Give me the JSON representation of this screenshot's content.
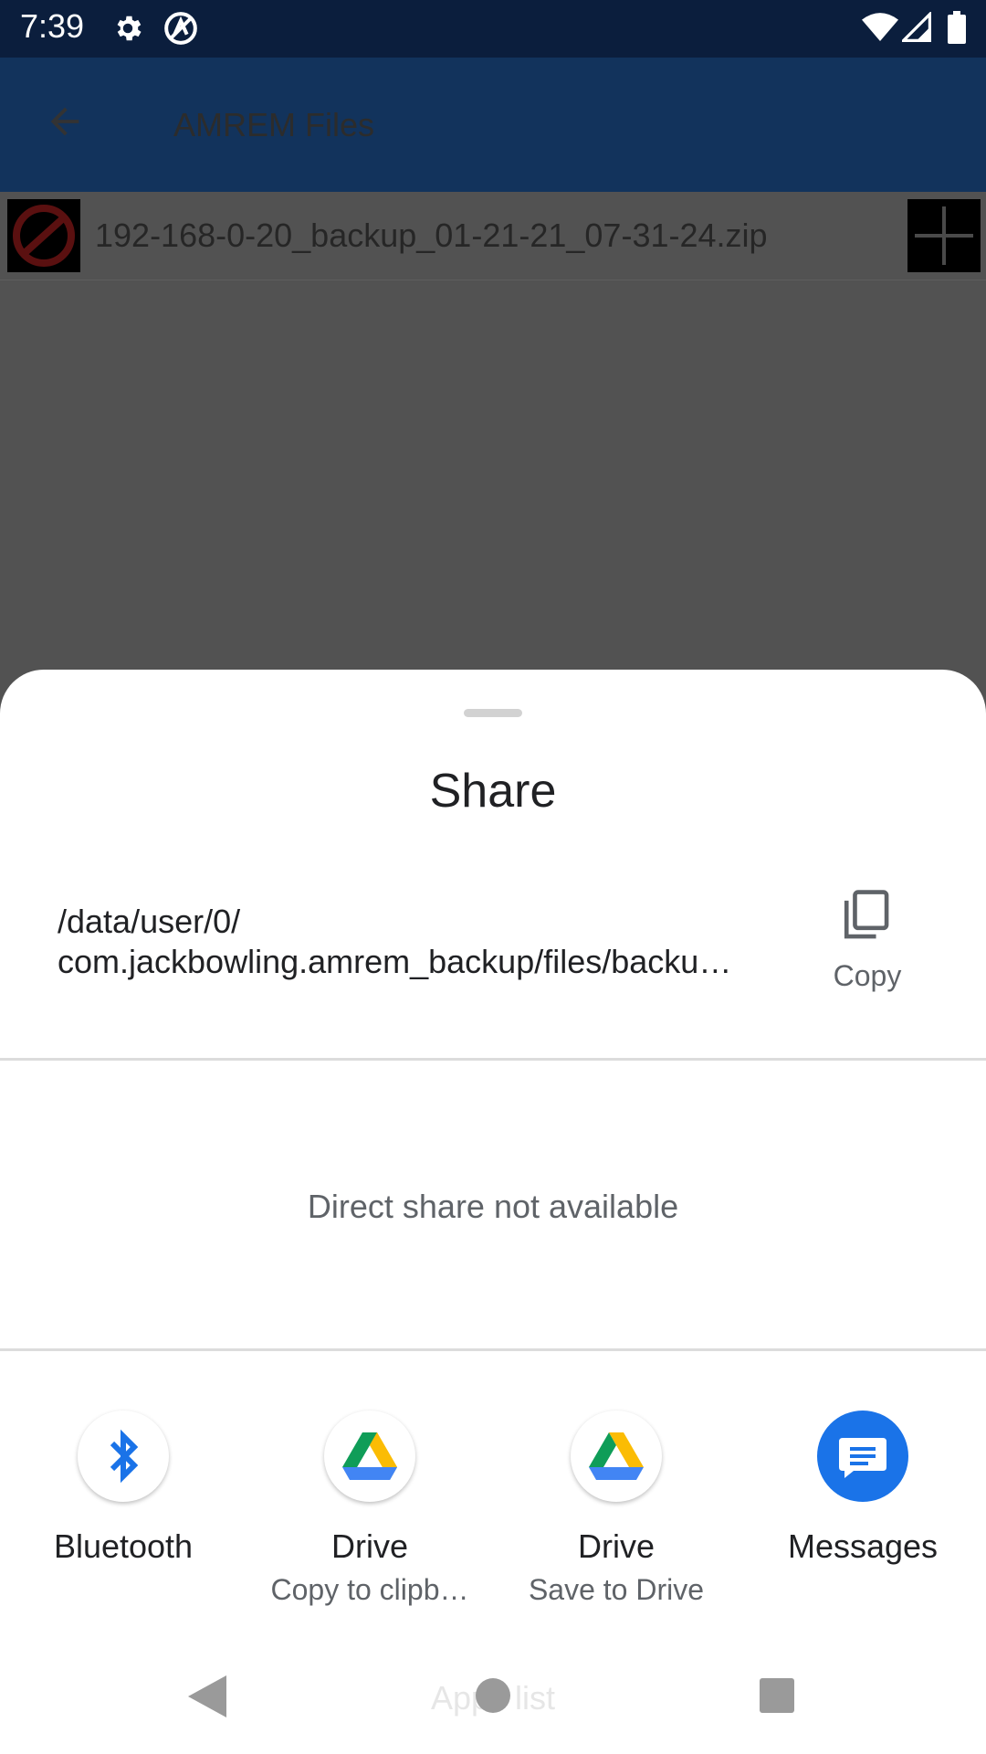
{
  "status_bar": {
    "time": "7:39",
    "icons": [
      "gear-icon",
      "alert-icon",
      "wifi-icon",
      "signal-icon",
      "battery-icon"
    ]
  },
  "app_bar": {
    "title": "AMREM Files",
    "back_icon": "back-arrow-icon"
  },
  "file_list": {
    "items": [
      {
        "name": "192-168-0-20_backup_01-21-21_07-31-24.zip",
        "icon": "no-entry-icon",
        "action_icon": "plus-icon"
      }
    ]
  },
  "share_sheet": {
    "title": "Share",
    "path_line1": "/data/user/0/",
    "path_line2": "com.jackbowling.amrem_backup/files/backu…",
    "copy_label": "Copy",
    "direct_share_text": "Direct share not available",
    "targets": [
      {
        "label": "Bluetooth",
        "sublabel": "",
        "icon": "bluetooth-icon"
      },
      {
        "label": "Drive",
        "sublabel": "Copy to clipb…",
        "icon": "drive-icon"
      },
      {
        "label": "Drive",
        "sublabel": "Save to Drive",
        "icon": "drive-icon"
      },
      {
        "label": "Messages",
        "sublabel": "",
        "icon": "messages-icon"
      }
    ]
  },
  "nav_bar": {
    "apps_list_text": "Apps list",
    "icons": [
      "back-triangle-icon",
      "home-circle-icon",
      "recents-square-icon"
    ]
  },
  "colors": {
    "status_bar": "#0b1e3d",
    "app_bar": "#12335c",
    "scrim_content": "#525252",
    "sheet": "#ffffff",
    "accent_blue": "#1a73e8"
  }
}
